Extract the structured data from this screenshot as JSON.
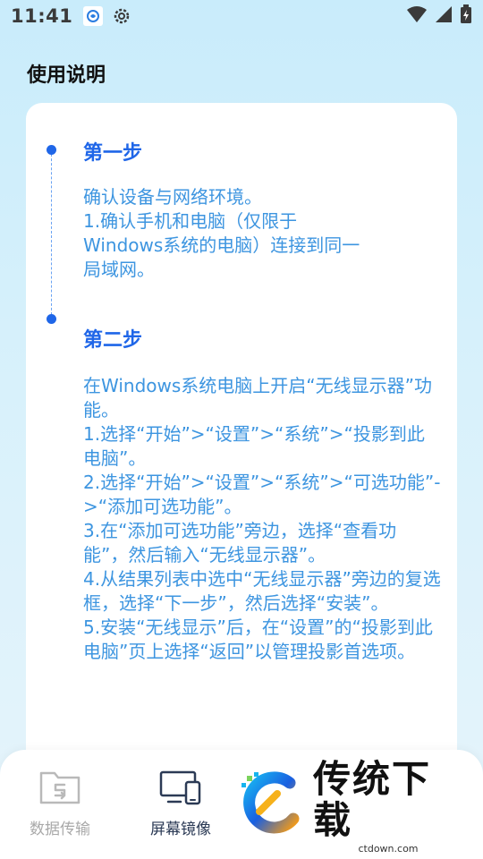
{
  "status_bar": {
    "time": "11:41",
    "icons": [
      "app-notification-icon",
      "settings-icon",
      "wifi-icon",
      "signal-icon",
      "battery-charging-icon"
    ]
  },
  "page": {
    "title": "使用说明"
  },
  "steps": [
    {
      "title": "第一步",
      "lines": [
        "确认设备与网络环境。",
        "1.确认手机和电脑（仅限于Windows系统的电脑）连接到同一局域网。"
      ]
    },
    {
      "title": "第二步",
      "lines": [
        "在Windows系统电脑上开启“无线显示器”功能。",
        "1.选择“开始”>“设置”>“系统”>“投影到此电脑”。",
        "2.选择“开始”>“设置”>“系统”>“可选功能”->“添加可选功能”。",
        "3.在“添加可选功能”旁边，选择“查看功能”，然后输入“无线显示器”。",
        "4.从结果列表中选中“无线显示器”旁边的复选框，选择“下一步”，然后选择“安装”。",
        "5.安装“无线显示”后，在“设置”的“投影到此电脑”页上选择“返回”以管理投影首选项。"
      ]
    }
  ],
  "bottom_nav": {
    "items": [
      {
        "label": "数据传输",
        "icon": "folder-transfer-icon",
        "active": false
      },
      {
        "label": "屏幕镜像",
        "icon": "screen-mirror-icon",
        "active": true
      }
    ]
  },
  "watermark": {
    "title": "传统下载",
    "subtitle": "ctdown.com"
  },
  "colors": {
    "accent": "#1f66e8",
    "step_text": "#3d95e0",
    "background_top": "#c9ecfb"
  }
}
